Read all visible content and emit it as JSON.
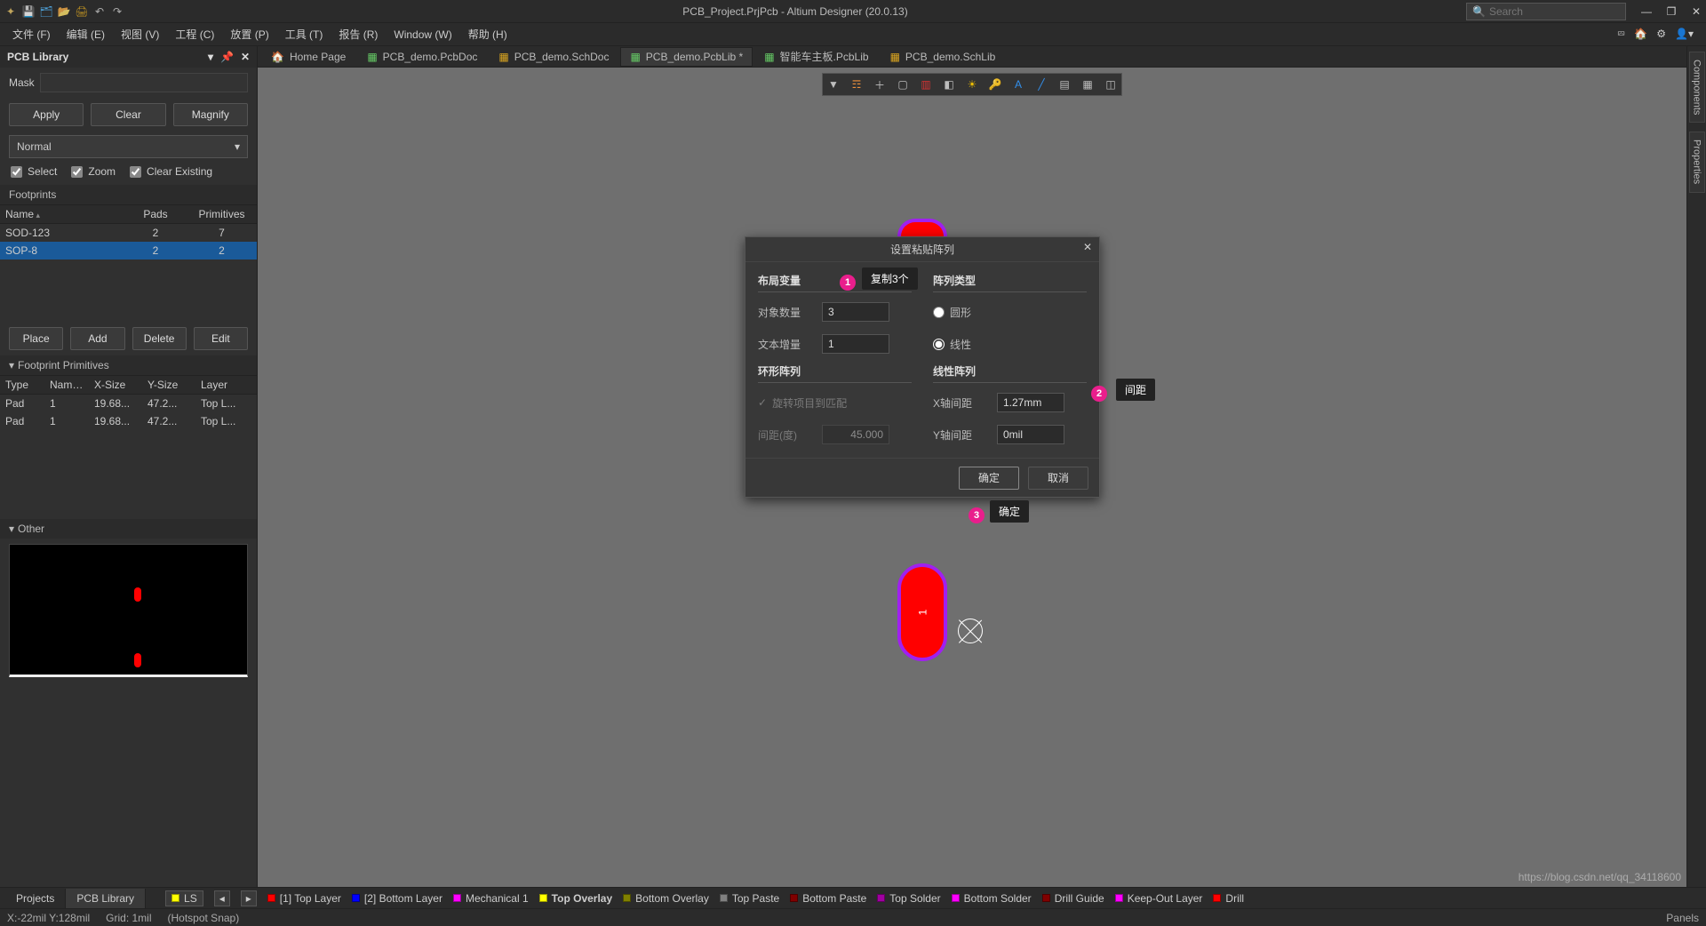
{
  "app_title": "PCB_Project.PrjPcb - Altium Designer (20.0.13)",
  "search_placeholder": "Search",
  "menu": [
    "文件 (F)",
    "编辑 (E)",
    "视图 (V)",
    "工程 (C)",
    "放置 (P)",
    "工具 (T)",
    "报告 (R)",
    "Window (W)",
    "帮助 (H)"
  ],
  "left": {
    "title": "PCB Library",
    "mask_label": "Mask",
    "apply": "Apply",
    "clear": "Clear",
    "magnify": "Magnify",
    "mode": "Normal",
    "chk_select": "Select",
    "chk_zoom": "Zoom",
    "chk_clear": "Clear Existing",
    "fp_section": "Footprints",
    "fp_cols": {
      "name": "Name",
      "pads": "Pads",
      "prims": "Primitives"
    },
    "fp_rows": [
      {
        "name": "SOD-123",
        "pads": "2",
        "prims": "7"
      },
      {
        "name": "SOP-8",
        "pads": "2",
        "prims": "2"
      }
    ],
    "place": "Place",
    "add": "Add",
    "delete": "Delete",
    "edit": "Edit",
    "prim_title": "Footprint Primitives",
    "prim_cols": {
      "type": "Type",
      "name": "Name",
      "xs": "X-Size",
      "ys": "Y-Size",
      "layer": "Layer"
    },
    "prim_rows": [
      {
        "type": "Pad",
        "name": "1",
        "xs": "19.68...",
        "ys": "47.2...",
        "layer": "Top L..."
      },
      {
        "type": "Pad",
        "name": "1",
        "xs": "19.68...",
        "ys": "47.2...",
        "layer": "Top L..."
      }
    ],
    "other_title": "Other"
  },
  "btabs": {
    "projects": "Projects",
    "pcblib": "PCB Library"
  },
  "doctabs": [
    {
      "label": "Home Page"
    },
    {
      "label": "PCB_demo.PcbDoc"
    },
    {
      "label": "PCB_demo.SchDoc"
    },
    {
      "label": "PCB_demo.PcbLib *",
      "active": true
    },
    {
      "label": "智能车主板.PcbLib"
    },
    {
      "label": "PCB_demo.SchLib"
    }
  ],
  "sidetabs": [
    "Components",
    "Properties"
  ],
  "dialog": {
    "title": "设置粘贴阵列",
    "g1": "布局变量",
    "g2": "阵列类型",
    "g3": "环形阵列",
    "g4": "线性阵列",
    "obj_count_l": "对象数量",
    "obj_count_v": "3",
    "txt_inc_l": "文本增量",
    "txt_inc_v": "1",
    "r_circle": "圆形",
    "r_linear": "线性",
    "rot_match": "旋转项目到匹配",
    "spacing_l": "间距(度)",
    "spacing_v": "45.000",
    "x_l": "X轴间距",
    "x_v": "1.27mm",
    "y_l": "Y轴间距",
    "y_v": "0mil",
    "ok": "确定",
    "cancel": "取消"
  },
  "annots": {
    "a1": "复制3个",
    "a2": "间距",
    "a3": "确定"
  },
  "layers": {
    "ls": "LS",
    "items": [
      {
        "c": "#ff0000",
        "t": "[1] Top Layer"
      },
      {
        "c": "#0000ff",
        "t": "[2] Bottom Layer"
      },
      {
        "c": "#ff00ff",
        "t": "Mechanical 1"
      },
      {
        "c": "#ffff00",
        "t": "Top Overlay",
        "bold": true
      },
      {
        "c": "#808000",
        "t": "Bottom Overlay"
      },
      {
        "c": "#808080",
        "t": "Top Paste"
      },
      {
        "c": "#800000",
        "t": "Bottom Paste"
      },
      {
        "c": "#a000a0",
        "t": "Top Solder"
      },
      {
        "c": "#ff00ff",
        "t": "Bottom Solder"
      },
      {
        "c": "#800000",
        "t": "Drill Guide"
      },
      {
        "c": "#ff00ff",
        "t": "Keep-Out Layer"
      },
      {
        "c": "#ff0000",
        "t": "Drill"
      }
    ]
  },
  "status": {
    "coord": "X:-22mil Y:128mil",
    "grid": "Grid: 1mil",
    "snap": "(Hotspot Snap)",
    "panels": "Panels"
  },
  "watermark": "https://blog.csdn.net/qq_34118600",
  "pad_number": "1"
}
